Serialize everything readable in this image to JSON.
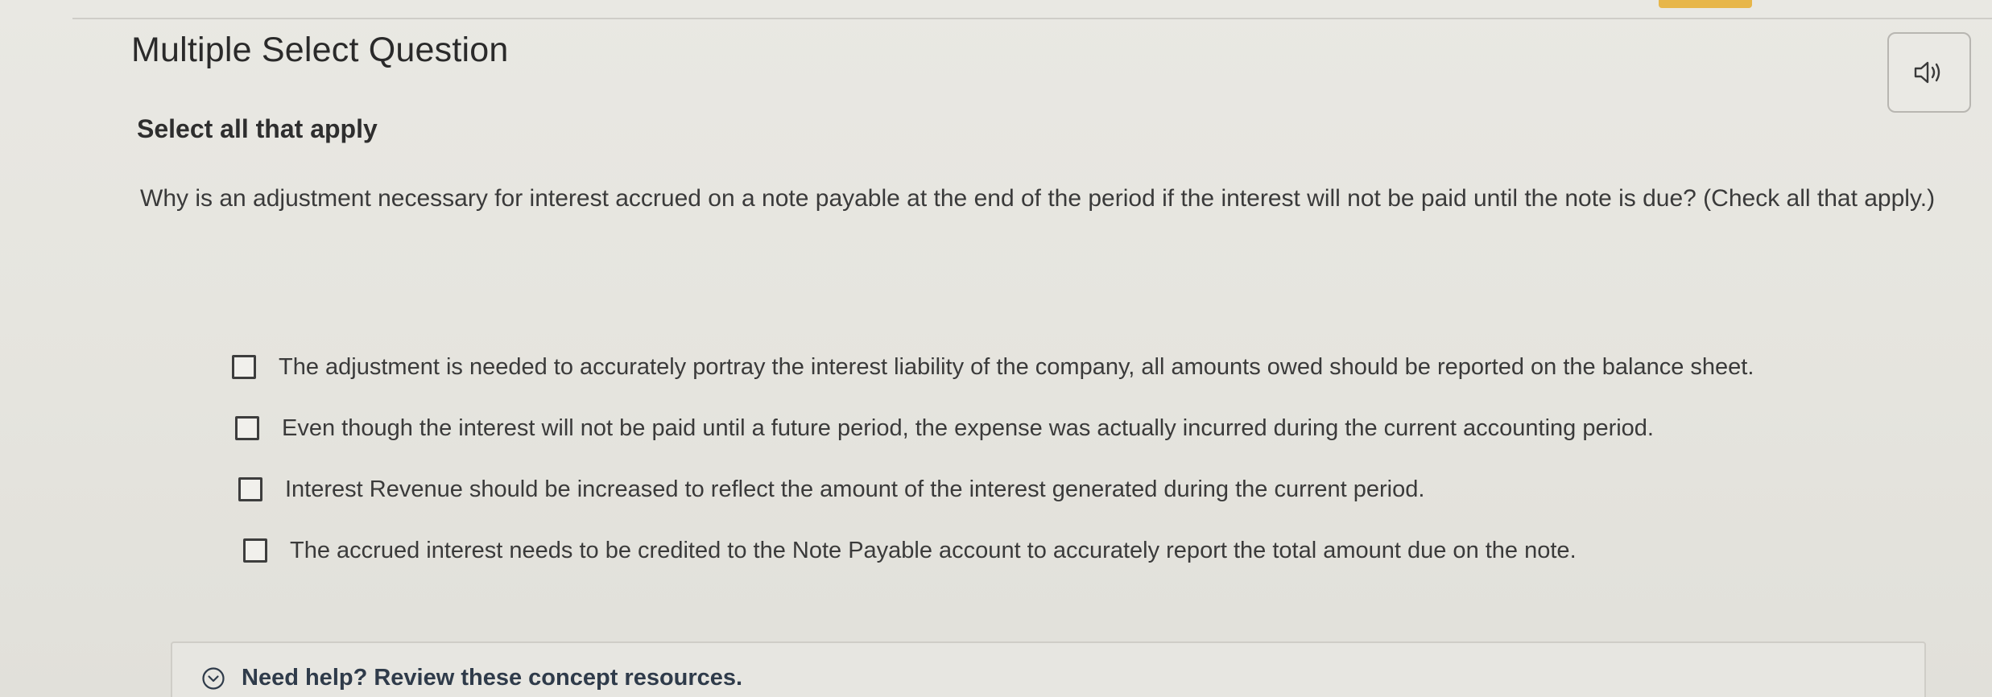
{
  "header": {
    "title": "Multiple Select Question"
  },
  "question": {
    "instruction": "Select all that apply",
    "prompt": "Why is an adjustment necessary for interest accrued on a note payable at the end of the period if the interest will not be paid until the note is due? (Check all that apply.)",
    "options": [
      {
        "label": "The adjustment is needed to accurately portray the interest liability of the company, all amounts owed should be reported on the balance sheet.",
        "checked": false
      },
      {
        "label": "Even though the interest will not be paid until a future period, the expense was actually incurred during the current accounting period.",
        "checked": false
      },
      {
        "label": "Interest Revenue should be increased to reflect the amount of the interest generated during the current period.",
        "checked": false
      },
      {
        "label": "The accrued interest needs to be credited to the Note Payable account to accurately report the total amount due on the note.",
        "checked": false
      }
    ]
  },
  "help": {
    "label": "Need help? Review these concept resources."
  },
  "icons": {
    "audio": "speaker-icon",
    "help": "chevron-down-circle-icon"
  },
  "colors": {
    "accent": "#e7b64a",
    "background": "#e6e5df"
  }
}
